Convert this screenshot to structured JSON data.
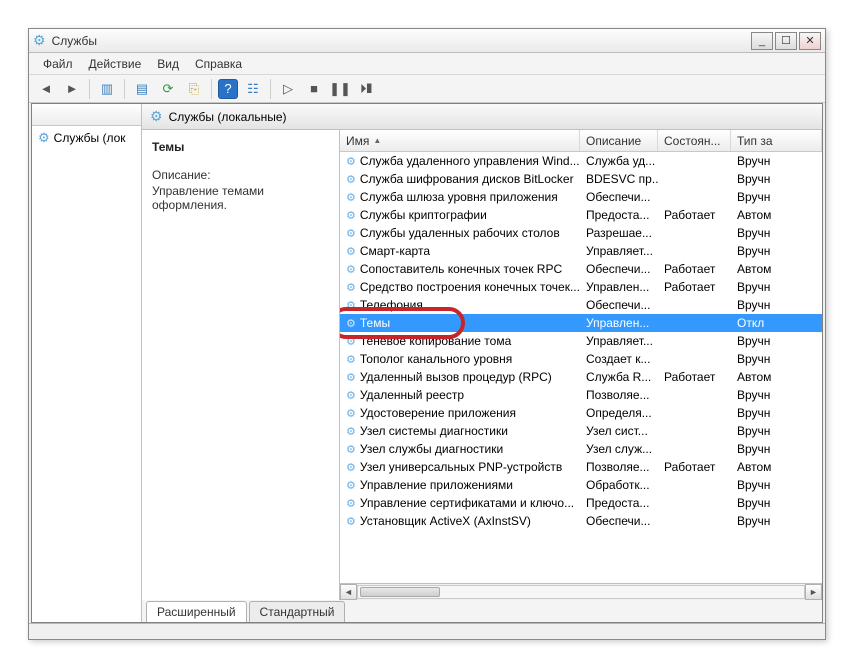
{
  "window": {
    "title": "Службы"
  },
  "menu": {
    "file": "Файл",
    "action": "Действие",
    "view": "Вид",
    "help": "Справка"
  },
  "tree": {
    "node": "Службы (лок"
  },
  "main_header": "Службы (локальные)",
  "desc": {
    "title": "Темы",
    "label": "Описание:",
    "text": "Управление темами оформления."
  },
  "columns": {
    "name": "Имя",
    "description": "Описание",
    "state": "Состоян...",
    "startup": "Тип за"
  },
  "col_widths": {
    "name": 240,
    "description": 78,
    "state": 73,
    "startup": 48
  },
  "rows": [
    {
      "name": "Служба удаленного управления Wind...",
      "desc": "Служба уд...",
      "state": "",
      "startup": "Вручн"
    },
    {
      "name": "Служба шифрования дисков BitLocker",
      "desc": "BDESVC пр...",
      "state": "",
      "startup": "Вручн"
    },
    {
      "name": "Служба шлюза уровня приложения",
      "desc": "Обеспечи...",
      "state": "",
      "startup": "Вручн"
    },
    {
      "name": "Службы криптографии",
      "desc": "Предоста...",
      "state": "Работает",
      "startup": "Автом"
    },
    {
      "name": "Службы удаленных рабочих столов",
      "desc": "Разрешае...",
      "state": "",
      "startup": "Вручн"
    },
    {
      "name": "Смарт-карта",
      "desc": "Управляет...",
      "state": "",
      "startup": "Вручн"
    },
    {
      "name": "Сопоставитель конечных точек RPC",
      "desc": "Обеспечи...",
      "state": "Работает",
      "startup": "Автом"
    },
    {
      "name": "Средство построения конечных точек...",
      "desc": "Управлен...",
      "state": "Работает",
      "startup": "Вручн"
    },
    {
      "name": "Телефония",
      "desc": "Обеспечи...",
      "state": "",
      "startup": "Вручн"
    },
    {
      "name": "Темы",
      "desc": "Управлен...",
      "state": "",
      "startup": "Откл",
      "selected": true
    },
    {
      "name": "Теневое копирование тома",
      "desc": "Управляет...",
      "state": "",
      "startup": "Вручн"
    },
    {
      "name": "Тополог канального уровня",
      "desc": "Создает к...",
      "state": "",
      "startup": "Вручн"
    },
    {
      "name": "Удаленный вызов процедур (RPC)",
      "desc": "Служба R...",
      "state": "Работает",
      "startup": "Автом"
    },
    {
      "name": "Удаленный реестр",
      "desc": "Позволяе...",
      "state": "",
      "startup": "Вручн"
    },
    {
      "name": "Удостоверение приложения",
      "desc": "Определя...",
      "state": "",
      "startup": "Вручн"
    },
    {
      "name": "Узел системы диагностики",
      "desc": "Узел сист...",
      "state": "",
      "startup": "Вручн"
    },
    {
      "name": "Узел службы диагностики",
      "desc": "Узел служ...",
      "state": "",
      "startup": "Вручн"
    },
    {
      "name": "Узел универсальных PNP-устройств",
      "desc": "Позволяе...",
      "state": "Работает",
      "startup": "Автом"
    },
    {
      "name": "Управление приложениями",
      "desc": "Обработк...",
      "state": "",
      "startup": "Вручн"
    },
    {
      "name": "Управление сертификатами и ключо...",
      "desc": "Предоста...",
      "state": "",
      "startup": "Вручн"
    },
    {
      "name": "Установщик ActiveX (AxInstSV)",
      "desc": "Обеспечи...",
      "state": "",
      "startup": "Вручн"
    }
  ],
  "tabs": {
    "extended": "Расширенный",
    "standard": "Стандартный"
  },
  "toolbar_icons": [
    "back",
    "forward",
    "|",
    "up",
    "|",
    "export",
    "refresh",
    "export-list",
    "|",
    "help",
    "properties",
    "|",
    "play",
    "stop",
    "pause",
    "restart"
  ]
}
